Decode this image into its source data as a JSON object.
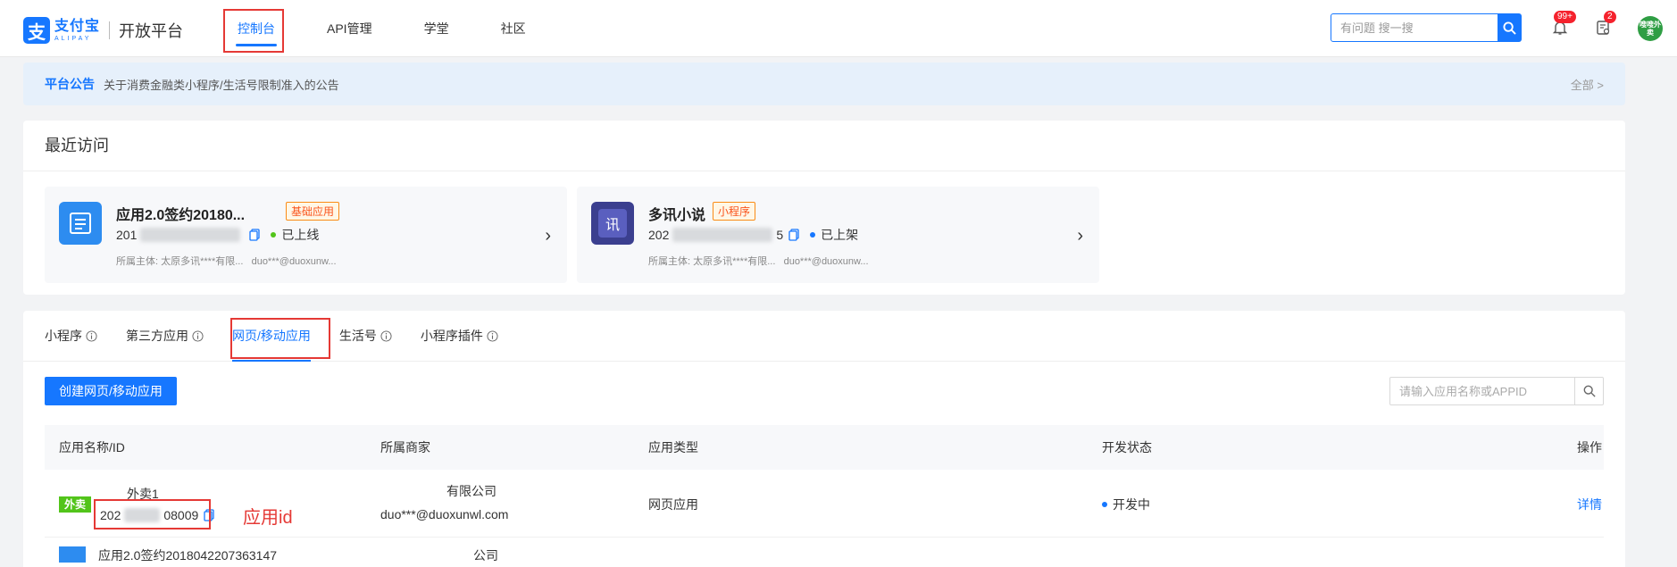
{
  "header": {
    "logo_cn": "支付宝",
    "logo_en": "ALIPAY",
    "platform": "开放平台",
    "nav": [
      "控制台",
      "API管理",
      "学堂",
      "社区"
    ],
    "search_placeholder": "有问题 搜一搜",
    "notification_badge": "99+",
    "task_badge": "2",
    "avatar_text": "嗖嗖外卖"
  },
  "notice": {
    "title": "平台公告",
    "text": "关于消费金融类小程序/生活号限制准入的公告",
    "all": "全部"
  },
  "recent": {
    "title": "最近访问",
    "cards": [
      {
        "name": "应用2.0签约20180...",
        "tag": "基础应用",
        "id_prefix": "201",
        "id_suffix": "",
        "status": "已上线",
        "owner": "所属主体: 太原多讯****有限...",
        "account": "duo***@duoxunw..."
      },
      {
        "name": "多讯小说",
        "tag": "小程序",
        "id_prefix": "202",
        "id_suffix": "5",
        "status": "已上架",
        "owner": "所属主体: 太原多讯****有限...",
        "account": "duo***@duoxunw..."
      }
    ]
  },
  "tabs": [
    "小程序",
    "第三方应用",
    "网页/移动应用",
    "生活号",
    "小程序插件"
  ],
  "list": {
    "create_button": "创建网页/移动应用",
    "search_placeholder": "请输入应用名称或APPID",
    "columns": [
      "应用名称/ID",
      "所属商家",
      "应用类型",
      "开发状态",
      "操作"
    ],
    "rows": [
      {
        "name": "外卖1",
        "id_prefix": "202",
        "id_suffix": "08009",
        "merchant": "有限公司",
        "account": "duo***@duoxunwl.com",
        "type": "网页应用",
        "status": "开发中",
        "action": "详情",
        "logo_text": "外卖"
      },
      {
        "name": "应用2.0签约2018042207363147",
        "merchant": "公司"
      }
    ],
    "annotation": "应用id"
  },
  "colors": {
    "primary": "#1677ff",
    "highlight": "#e53935"
  }
}
